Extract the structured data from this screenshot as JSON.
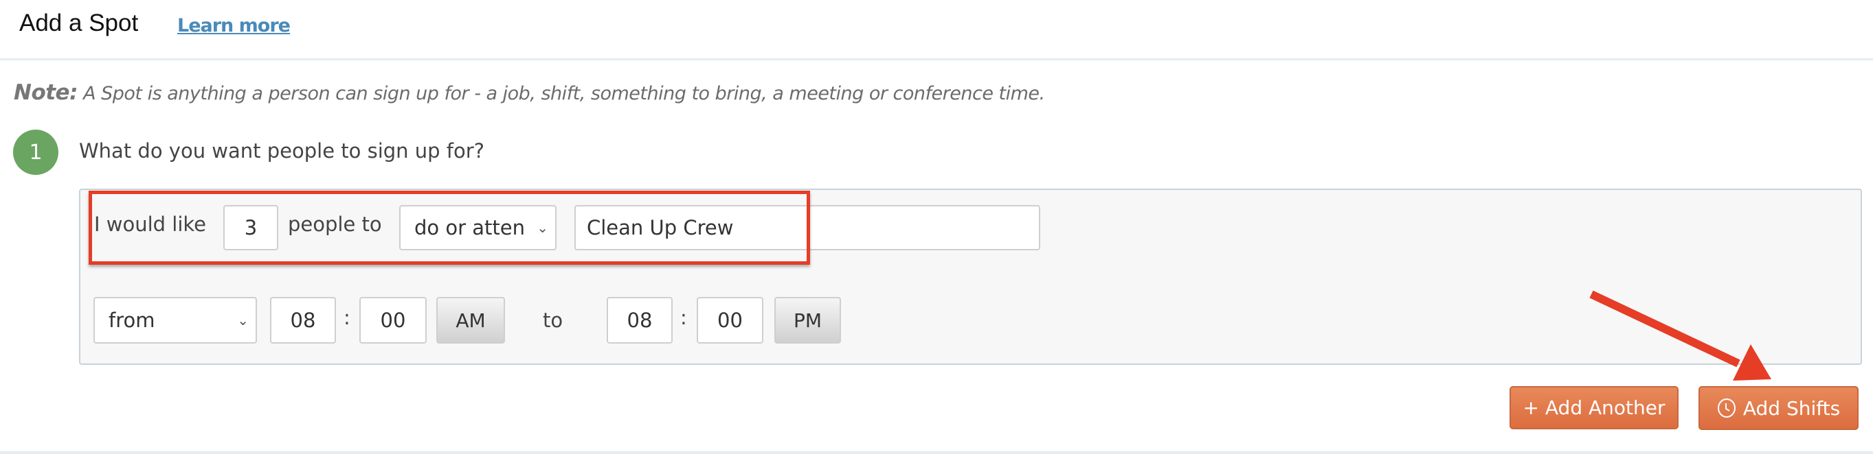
{
  "header": {
    "title": "Add a Spot",
    "learn_more": "Learn more"
  },
  "note": {
    "label": "Note:",
    "text": " A Spot is anything a person can sign up for - a job, shift, something to bring, a meeting or conference time."
  },
  "step": {
    "number": "1",
    "question": "What do you want people to sign up for?"
  },
  "form": {
    "prefix": "I would like",
    "quantity": "3",
    "middle": "people to",
    "action_select": "do or atten",
    "spot_name": "Clean Up Crew",
    "range_select": "from",
    "start_hour": "08",
    "start_min": "00",
    "start_ampm": "AM",
    "to_label": "to",
    "end_hour": "08",
    "end_min": "00",
    "end_ampm": "PM",
    "colon": ":"
  },
  "buttons": {
    "add_another": "+ Add Another",
    "add_shifts": "Add Shifts"
  },
  "icons": {
    "chevron": "chevron-down-icon",
    "clock": "clock-icon"
  },
  "colors": {
    "accent": "#e07a4b",
    "annotation": "#e53d26",
    "step": "#6ba562",
    "link": "#4a8ab8"
  }
}
